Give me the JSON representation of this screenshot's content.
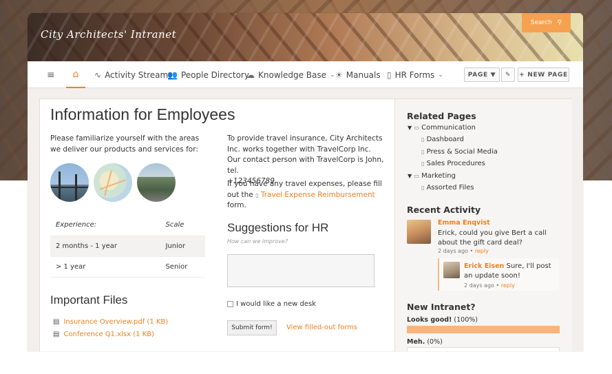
{
  "site": {
    "title": "City Architects' Intranet",
    "search_label": "Search"
  },
  "nav": {
    "items": [
      {
        "label": "Activity Stream"
      },
      {
        "label": "People Directory"
      },
      {
        "label": "Knowledge Base"
      },
      {
        "label": "Manuals"
      },
      {
        "label": "HR Forms"
      }
    ],
    "page_button": "PAGE ▼",
    "new_page_button": "+ NEW PAGE"
  },
  "main": {
    "title": "Information for Employees",
    "intro": "Please familiarize yourself with the areas we deliver our products and services for:",
    "experience_table": {
      "headers": [
        "Experience:",
        "Scale"
      ],
      "rows": [
        [
          "2 months - 1 year",
          "Junior"
        ],
        [
          "> 1 year",
          "Senior"
        ]
      ]
    },
    "insurance_text": "To provide travel insurance, City Architects Inc. works together with TravelCorp Inc. Our contact person with TravelCorp is John, tel.",
    "phone": "+123456789",
    "expenses_pre": "If you have any travel expenses, please fill out the",
    "expenses_link": "Travel Expense Reimbursement",
    "expenses_post": "form.",
    "suggestions_title": "Suggestions for HR",
    "suggestions_placeholder": "How can we improve?",
    "checkbox_label": "I would like a new desk",
    "submit_label": "Submit form!",
    "view_forms_link": "View filled-out forms",
    "files_title": "Important Files",
    "files": [
      "Insurance Overview.pdf (1 KB)",
      "Conference Q1.xlsx (1 KB)"
    ]
  },
  "sidebar": {
    "related_title": "Related Pages",
    "tree": {
      "communication": "Communication",
      "communication_children": [
        "Dashboard",
        "Press & Social Media",
        "Sales Procedures"
      ],
      "marketing": "Marketing",
      "marketing_children": [
        "Assorted Files"
      ]
    },
    "activity_title": "Recent Activity",
    "activity": {
      "author": "Emma Enqvist",
      "text": "Erick, could you give Bert a call about the gift card deal?",
      "time": "2 days ago",
      "reply": "reply",
      "reply_author": "Erick Eisen",
      "reply_text": "Sure, I'll post an update soon!",
      "reply_time": "2 days ago",
      "reply_reply": "reply"
    },
    "poll_title": "New Intranet?",
    "poll": [
      {
        "label": "Looks good!",
        "pct": "(100%)",
        "value": 100
      },
      {
        "label": "Meh.",
        "pct": "(0%)",
        "value": 0
      }
    ],
    "accent": "#f07f1e",
    "bar_color": "#f9b47c"
  }
}
